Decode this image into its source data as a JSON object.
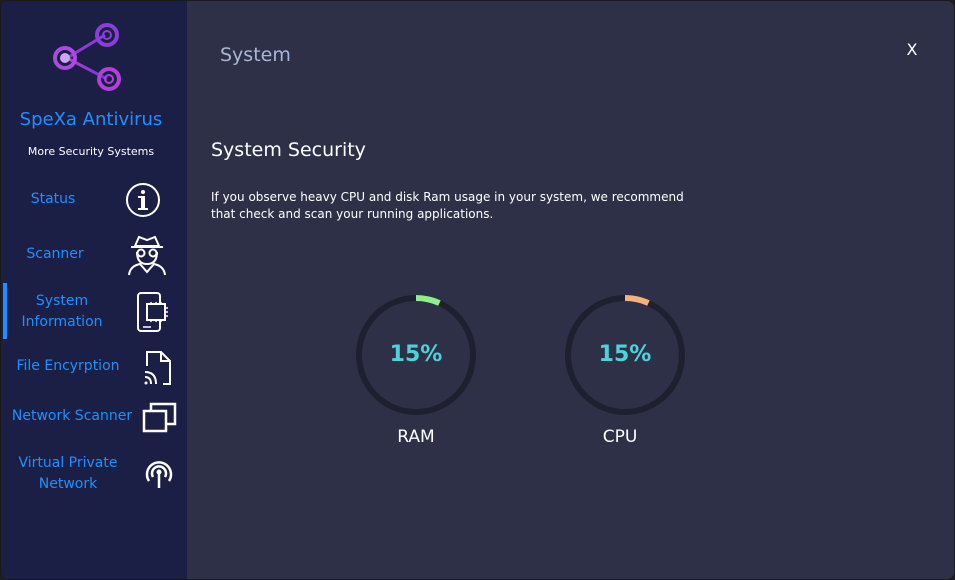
{
  "app": {
    "name": "SpeXa Antivirus",
    "subtitle": "More Security Systems"
  },
  "sidebar": {
    "items": [
      {
        "label": "Status",
        "icon": "info-icon",
        "active": false
      },
      {
        "label": "Scanner",
        "icon": "spy-icon",
        "active": false
      },
      {
        "label": "System Information",
        "icon": "phone-chip-icon",
        "active": true
      },
      {
        "label": "File Encyrption",
        "icon": "file-cast-icon",
        "active": false
      },
      {
        "label": "Network Scanner",
        "icon": "windows-stack-icon",
        "active": false
      },
      {
        "label": "Virtual Private Network",
        "icon": "broadcast-icon",
        "active": false
      }
    ]
  },
  "header": {
    "title": "System",
    "close_label": "X"
  },
  "main": {
    "heading": "System Security",
    "description": "If you observe heavy CPU and disk Ram usage in your system, we recommend that check and scan your running applications.",
    "gauges": [
      {
        "label": "RAM",
        "value_text": "15%",
        "percent": 15,
        "color": "#8ef08b"
      },
      {
        "label": "CPU",
        "value_text": "15%",
        "percent": 15,
        "color": "#f5b27a"
      }
    ]
  },
  "colors": {
    "accent": "#1e90ff",
    "sidebar_bg": "#1c1f45",
    "content_bg": "#2e3047",
    "gauge_text": "#4fd1d9",
    "ring_track": "#1e2030"
  }
}
